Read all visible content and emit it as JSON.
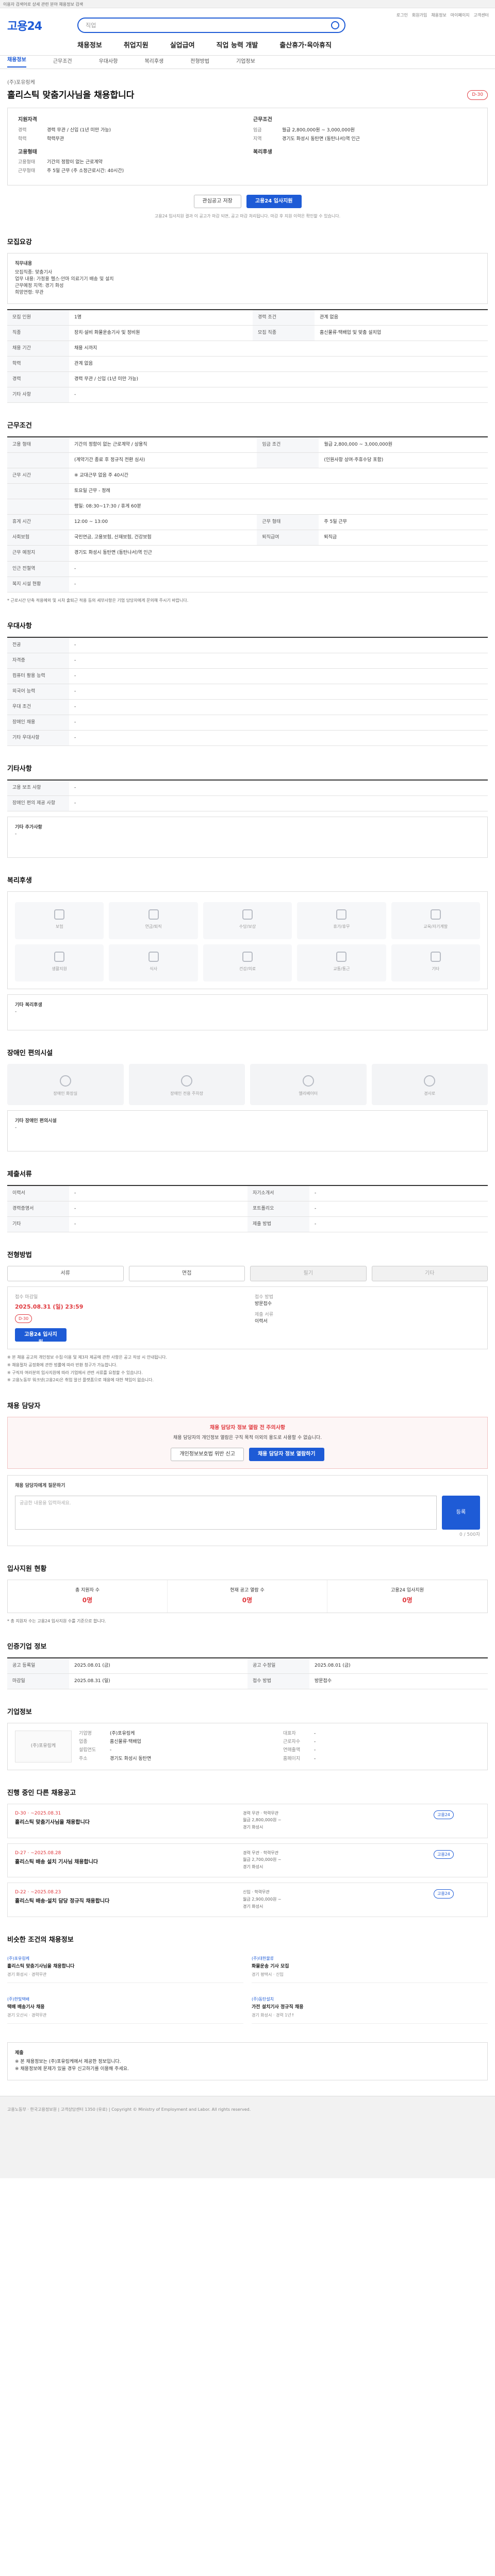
{
  "topbar": {
    "text": "이용자 검색어로 상세 관련 분야 채용정보 검색"
  },
  "header": {
    "logo_a": "고용",
    "logo_b": "24",
    "search_placeholder": "직업",
    "links": [
      "로그인",
      "회원가입",
      "채용정보",
      "마이페이지",
      "고객센터"
    ],
    "gnb": [
      "채용정보",
      "취업지원",
      "실업급여",
      "직업 능력 개발",
      "출산휴가·육아휴직"
    ]
  },
  "subnav": [
    "채용정보",
    "근무조건",
    "우대사항",
    "복리후생",
    "전형방법",
    "기업정보"
  ],
  "job": {
    "company": "(주)포유링케",
    "title": "홀리스틱 맞춤기사님을 채용합니다",
    "tag": "D-30",
    "summary_left_title": "지원자격",
    "summary_left": [
      {
        "k": "경력",
        "v": "경력 무관 / 신입 (1년 미만 가능)"
      },
      {
        "k": "학력",
        "v": "학력무관"
      }
    ],
    "summary_left_title2": "고용형태",
    "summary_left2": [
      {
        "k": "고용형태",
        "v": "기간의 정함이 없는 근로계약"
      },
      {
        "k": "근무형태",
        "v": "주 5일 근무 (주 소정근로시간: 40시간)"
      }
    ],
    "summary_right_title": "근무조건",
    "summary_right": [
      {
        "k": "임금",
        "v": "월급 2,800,000원 ~ 3,000,000원"
      },
      {
        "k": "지역",
        "v": "경기도 화성시 동탄면 (동탄나서)역 인근"
      }
    ],
    "summary_right_title2": "복리후생",
    "summary_right2": [
      {
        "k": "",
        "v": ""
      }
    ],
    "btn_scrap": "관심공고 저장",
    "btn_apply": "고용24 입사지원",
    "note": "고용24 입사지원 결과 이 공고가 마감 되면, 공고 마감 처리됩니다. 마감 후 지원 이력은 확인할 수 있습니다."
  },
  "sections": {
    "recruit": {
      "title": "모집요강",
      "desc_label": "직무내용",
      "desc_lines": [
        "모집직종: 맞춤기사",
        "업무 내용: 가정용 헬스·안마 의료기기 배송 및 설치",
        "근무예정 지역: 경기 화성",
        "희망연령: 무관"
      ],
      "rows": [
        [
          "모집 인원",
          "1명",
          "경력 조건",
          "관계 없음"
        ],
        [
          "직종",
          "장치·설비 화물운송기사 및 정비원",
          "모집 직종",
          "홈신물류·택배업 및 맞춤 설치업"
        ],
        [
          "채용 기간",
          "채용 시까지",
          "",
          ""
        ],
        [
          "학력",
          "관계 없음",
          "",
          ""
        ],
        [
          "경력",
          "경력 무관 / 신입 (1년 미만 가능)",
          "",
          ""
        ],
        [
          "기타 사항",
          "-",
          "",
          ""
        ]
      ]
    },
    "conditions": {
      "title": "근무조건",
      "rows": [
        [
          "고용 형태",
          "기간의 정함이 없는 근로계약 / 상용직",
          "임금 조건",
          "월급 2,800,000 ~ 3,000,000원"
        ],
        [
          "",
          "(계약기간 종료 후 정규직 전환 심사)",
          "",
          "(인원사항 상여·주휴수당 포함)"
        ],
        [
          "근무 시간",
          "※ 교대근무 없음 주 40시간",
          "",
          ""
        ],
        [
          "",
          "토요일 근무 - 정례",
          "",
          ""
        ],
        [
          "",
          "평일: 08:30~17:30 / 휴게 60분",
          "",
          ""
        ],
        [
          "휴게 시간",
          "12:00 ~ 13:00",
          "근무 형태",
          "주 5일 근무"
        ],
        [
          "사회보험",
          "국민연금, 고용보험, 산재보험, 건강보험",
          "퇴직급여",
          "퇴직금"
        ],
        [
          "근무 예정지",
          "경기도 화성시 동탄면 (동탄나서)역 인근",
          "",
          ""
        ],
        [
          "인근 전철역",
          "-",
          "",
          ""
        ],
        [
          "복지 시설 현황",
          "-",
          "",
          ""
        ]
      ],
      "note": "* 근로시간 단축 적용예외 및 시차 출퇴근 적용 등의 세부사항은 기업 담당자에게 문의해 주시기 바랍니다."
    },
    "prefer": {
      "title": "우대사항",
      "rows": [
        [
          "전공",
          "-"
        ],
        [
          "자격증",
          "-"
        ],
        [
          "컴퓨터 활용 능력",
          "-"
        ],
        [
          "외국어 능력",
          "-"
        ],
        [
          "우대 조건",
          "-"
        ],
        [
          "장애인 채용",
          "-"
        ],
        [
          "기타 우대사항",
          "-"
        ]
      ]
    },
    "extra": {
      "title": "기타사항",
      "rows": [
        [
          "고용 보조 사항",
          "-"
        ],
        [
          "장애인 편의 제공 사항",
          "-"
        ]
      ],
      "box_label": "기타 추가사항",
      "box_text": "-"
    },
    "welfare": {
      "title": "복리후생",
      "tiles": [
        "보험",
        "연금/퇴직",
        "수당/보상",
        "휴가/휴무",
        "교육/자기계발",
        "생활지원",
        "식사",
        "건강/의료",
        "교통/통근",
        "기타"
      ],
      "box_label": "기타 복리후생",
      "box_text": "-"
    },
    "facility": {
      "title": "장애인 편의시설",
      "tiles": [
        "장애인 화장실",
        "장애인 전용 주차장",
        "엘리베이터",
        "경사로"
      ],
      "box_label": "기타 장애인 편의시설",
      "box_text": "-"
    },
    "docs": {
      "title": "제출서류",
      "rows": [
        [
          "이력서",
          "-",
          "자기소개서",
          "-"
        ],
        [
          "경력증명서",
          "-",
          "포트폴리오",
          "-"
        ],
        [
          "기타",
          "-",
          "제출 방법",
          "-"
        ]
      ]
    },
    "method": {
      "title": "전형방법",
      "buttons": [
        "서류",
        "면접",
        "필기",
        "기타"
      ],
      "deadline_label": "접수 마감일",
      "deadline": "2025.08.31 (일) 23:59",
      "deadline_tag": "D-30",
      "apply_label": "접수 방법",
      "apply_value": "방문접수",
      "apply2_label": "제출 서류",
      "apply2_value": "이력서",
      "bullets": [
        "※ 본 채용 공고의 개인정보 수집·이용 및 제3자 제공에 관한 사항은 공고 작성 시 안내됩니다.",
        "※ 채용절차 공정화에 관한 법률에 따라 반환 청구가 가능합니다.",
        "※ 구직자 여러분의 입사지원에 따라 기업에서 관련 서류를 요청할 수 있습니다.",
        "※ 고용노동부 워크넷(고용24)은 취업 알선 플랫폼으로 채용에 대한 책임이 없습니다."
      ]
    },
    "qna": {
      "title": "채용 담당자",
      "warn_title": "채용 담당자 정보 열람 전 주의사항",
      "warn_text": "채용 담당자의 개인정보 열람은 구직 목적 이외의 용도로 사용할 수 없습니다.",
      "btn_a": "개인정보보호법 위반 신고",
      "btn_b": "채용 담당자 정보 열람하기",
      "qa_label": "채용 담당자에게 질문하기",
      "qa_placeholder": "궁금한 내용을 입력하세요.",
      "qa_btn": "등록",
      "qa_count": "0 / 500자"
    },
    "stats": {
      "title": "입사지원 현황",
      "cols": [
        {
          "label": "총 지원자 수",
          "num": "0명"
        },
        {
          "label": "현재 공고 열람 수",
          "num": "0명"
        },
        {
          "label": "고용24 입사지원",
          "num": "0명"
        }
      ],
      "note": "* 총 지원자 수는 고용24 입사지원 수를 기준으로 합니다."
    },
    "notice": {
      "title": "인증기업 정보",
      "rows": [
        [
          "공고 등록일",
          "2025.08.01 (금)",
          "공고 수정일",
          "2025.08.01 (금)"
        ],
        [
          "마감일",
          "2025.08.31 (일)",
          "접수 방법",
          "방문접수"
        ]
      ]
    },
    "company": {
      "title": "기업정보",
      "logo": "(주)포유링케",
      "info": [
        [
          "기업명",
          "(주)포유링케"
        ],
        [
          "대표자",
          "-"
        ],
        [
          "업종",
          "홈신물류·택배업"
        ],
        [
          "근로자수",
          "-"
        ],
        [
          "설립연도",
          "-"
        ],
        [
          "연매출액",
          "-"
        ],
        [
          "주소",
          "경기도 화성시 동탄면"
        ],
        [
          "홈페이지",
          "-"
        ]
      ]
    },
    "prev": {
      "title": "진행 중인 다른 채용공고",
      "items": [
        {
          "date": "D-30 · ~2025.08.31",
          "title": "홀리스틱 맞춤기사님을 채용합니다",
          "cond": [
            "경력 무관 · 학력무관",
            "월급 2,800,000원 ~",
            "경기 화성시"
          ],
          "chip": "고용24"
        },
        {
          "date": "D-27 · ~2025.08.28",
          "title": "홀리스틱 배송 설치 기사님 채용합니다",
          "cond": [
            "경력 무관 · 학력무관",
            "월급 2,700,000원 ~",
            "경기 화성시"
          ],
          "chip": "고용24"
        },
        {
          "date": "D-22 · ~2025.08.23",
          "title": "홀리스틱 배송·설치 담당 정규직 채용합니다",
          "cond": [
            "신입 · 학력무관",
            "월급 2,900,000원 ~",
            "경기 화성시"
          ],
          "chip": "고용24"
        }
      ]
    },
    "similar": {
      "title": "비슷한 조건의 채용정보",
      "items": [
        {
          "co": "(주)포유링케",
          "tt": "홀리스틱 맞춤기사님을 채용합니다",
          "mt": "경기 화성시 · 경력무관"
        },
        {
          "co": "(주)대한물류",
          "tt": "화물운송 기사 모집",
          "mt": "경기 평택시 · 신입"
        },
        {
          "co": "(주)한빛택배",
          "tt": "택배 배송기사 채용",
          "mt": "경기 오산시 · 경력무관"
        },
        {
          "co": "(주)동탄설치",
          "tt": "가전 설치기사 정규직 채용",
          "mt": "경기 화성시 · 경력 1년↑"
        }
      ]
    },
    "bottom": {
      "label": "제출",
      "lines": [
        "※ 본 채용정보는 (주)포유링케에서 제공한 정보입니다.",
        "※ 채용정보에 문제가 있을 경우 신고하기를 이용해 주세요."
      ]
    }
  },
  "footer": {
    "text": "고용노동부 · 한국고용정보원 | 고객상담센터 1350 (유료) | Copyright © Ministry of Employment and Labor. All rights reserved."
  }
}
